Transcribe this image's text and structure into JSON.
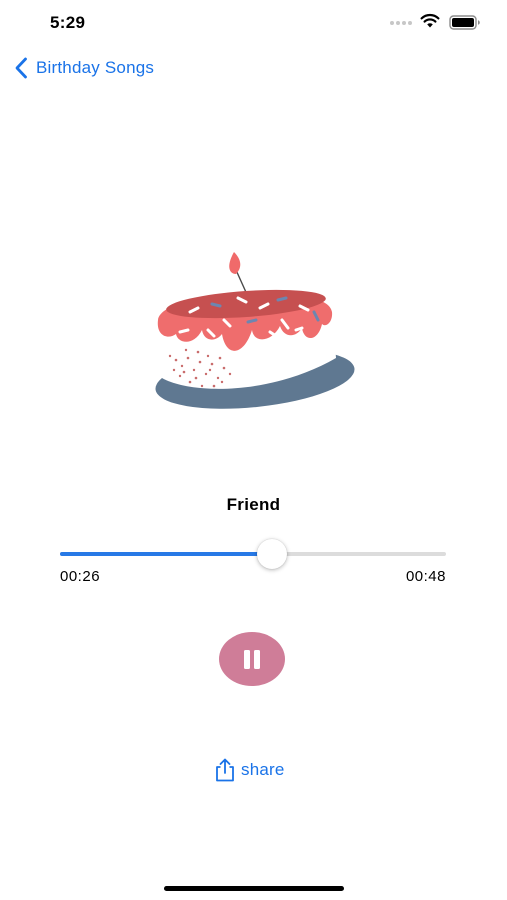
{
  "status_bar": {
    "time": "5:29",
    "icons": [
      "signal-dots-icon",
      "wifi-icon",
      "battery-icon"
    ]
  },
  "nav": {
    "back_label": "Birthday Songs",
    "back_icon": "chevron-left-icon",
    "accent_color": "#1a73e8"
  },
  "artwork": {
    "icon": "birthday-cake-icon"
  },
  "track": {
    "title": "Friend"
  },
  "player": {
    "elapsed": "00:26",
    "total": "00:48",
    "progress": 0.55,
    "progress_color": "#2779e6",
    "button_color": "#cf7d98",
    "play_state_icon": "pause-icon"
  },
  "share": {
    "label": "share",
    "icon": "share-icon"
  }
}
